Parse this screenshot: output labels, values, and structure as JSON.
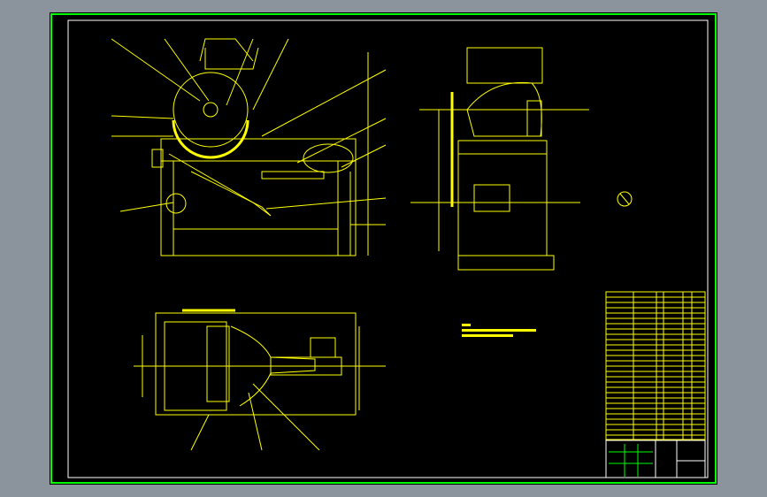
{
  "viewer": {
    "background_color": "#8b939c"
  },
  "drawing": {
    "sheet_color": "#000000",
    "outer_border_color": "#00ff00",
    "inner_border_color": "#ffffff",
    "line_color": "#ffff00",
    "title_block_color": "#00ff00"
  }
}
